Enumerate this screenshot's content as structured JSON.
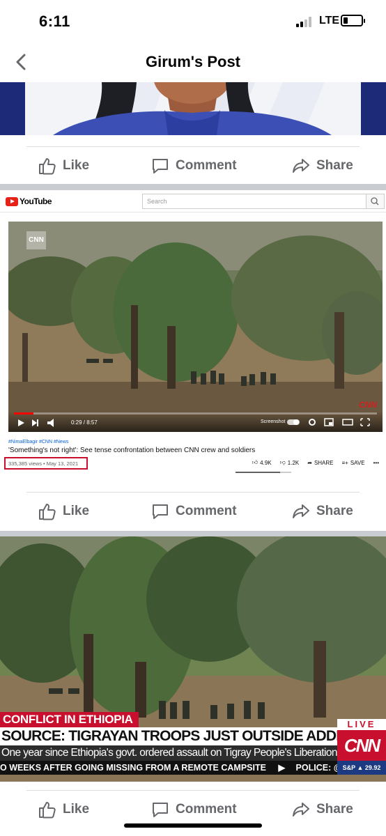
{
  "status": {
    "time": "6:11",
    "network": "LTE",
    "battery_level": 0.25,
    "signal_bars": 2
  },
  "header": {
    "title": "Girum's Post",
    "back_icon": "chevron-left-icon"
  },
  "actions": {
    "like": "Like",
    "comment": "Comment",
    "share": "Share"
  },
  "youtube": {
    "logo": "YouTube",
    "search_placeholder": "Search",
    "cnn_bug": "CNN",
    "cnn_corner": "CNN",
    "time": "0:29 / 8:57",
    "progress": 0.054,
    "screenshot_label": "Screenshot",
    "tags": "#NimaElbagir #CNN #News",
    "title": "'Something's not right': See tense confrontation between CNN crew and soldiers",
    "meta": "335,385 views • May 13, 2021",
    "likes": "4.9K",
    "dislikes": "1.2K",
    "share": "SHARE",
    "save": "SAVE",
    "like_ratio": 0.8
  },
  "cnn": {
    "chyron_top": "CONFLICT IN ETHIOPIA",
    "chyron_main": "SOURCE: TIGRAYAN TROOPS JUST OUTSIDE ADDIS ABABA",
    "chyron_sub": "One year since Ethiopia's govt. ordered assault on Tigray People's Liberation Front",
    "ticker": "O WEEKS AFTER GOING MISSING FROM A REMOTE CAMPSITE",
    "ticker_2": "POLICE: @BIANCA NOBILO",
    "live": "LIVE",
    "logo": "CNN",
    "market": "S&P ▲ 29.92"
  },
  "colors": {
    "fb_gray": "#65676b",
    "cnn_red": "#c8102e",
    "yt_red": "#e62117"
  }
}
